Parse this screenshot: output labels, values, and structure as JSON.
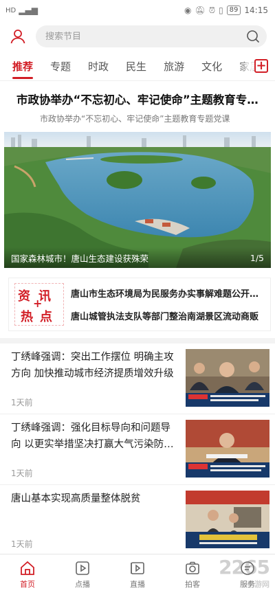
{
  "status_bar": {
    "carrier": "HD",
    "battery": "89",
    "time": "14:15"
  },
  "search": {
    "placeholder": "搜索节目"
  },
  "tabs": [
    {
      "label": "推荐",
      "active": true
    },
    {
      "label": "专题"
    },
    {
      "label": "时政"
    },
    {
      "label": "民生"
    },
    {
      "label": "旅游"
    },
    {
      "label": "文化"
    },
    {
      "label": "家居"
    }
  ],
  "headline": {
    "title": "市政协举办“不忘初心、牢记使命”主题教育专题党课",
    "subtitle": "市政协举办“不忘初心、牢记使命”主题教育专题党课"
  },
  "banner": {
    "caption": "国家森林城市！唐山生态建设获殊荣",
    "page": "1/5"
  },
  "hot_news": {
    "logo": [
      "资",
      "讯",
      "+",
      "热",
      "点"
    ],
    "items": [
      "唐山市生态环境局为民服务办实事解难题公开承诺",
      "唐山城管执法支队等部门整治南湖景区流动商贩"
    ]
  },
  "news": [
    {
      "title": "丁绣峰强调：突出工作摆位 明确主攻方向 加快推动城市经济提质增效升级",
      "time": "1天前"
    },
    {
      "title": "丁绣峰强调：强化目标导向和问题导向 以更实举措坚决打赢大气污染防治攻坚战",
      "time": "1天前"
    },
    {
      "title": "唐山基本实现高质量整体脱贫",
      "time": "1天前"
    }
  ],
  "tabbar": [
    {
      "label": "首页",
      "icon": "home-icon",
      "active": true
    },
    {
      "label": "点播",
      "icon": "play-icon"
    },
    {
      "label": "直播",
      "icon": "live-icon"
    },
    {
      "label": "拍客",
      "icon": "camera-icon"
    },
    {
      "label": "服务",
      "icon": "service-icon"
    }
  ],
  "watermark": {
    "logo": "2265",
    "sub": "手游网"
  },
  "colors": {
    "accent": "#d21e26"
  }
}
